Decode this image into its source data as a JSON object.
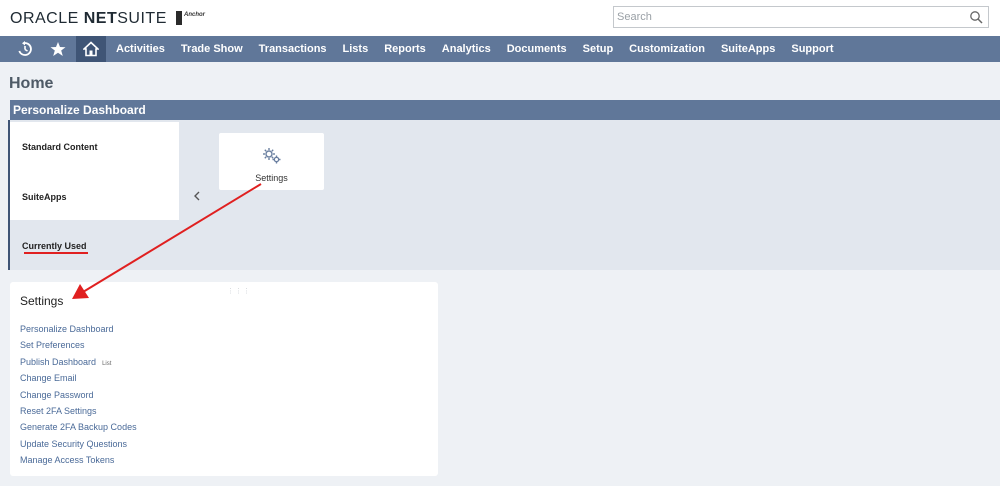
{
  "header": {
    "logo_oracle": "ORACLE ",
    "logo_net": "NET",
    "logo_suite": "SUITE",
    "company_logo_text": "Anchor",
    "search_placeholder": "Search"
  },
  "navbar": {
    "icons": [
      "recent-records-icon",
      "star-icon",
      "home-icon"
    ],
    "items": [
      "Activities",
      "Trade Show",
      "Transactions",
      "Lists",
      "Reports",
      "Analytics",
      "Documents",
      "Setup",
      "Customization",
      "SuiteApps",
      "Support"
    ]
  },
  "page": {
    "title": "Home"
  },
  "personalize": {
    "header": "Personalize Dashboard",
    "menu": [
      "Standard Content",
      "SuiteApps",
      "Currently Used"
    ],
    "tile_label": "Settings"
  },
  "portlet": {
    "title": "Settings",
    "links": [
      "Personalize Dashboard",
      "Set Preferences",
      "Publish Dashboard",
      "Change Email",
      "Change Password",
      "Reset 2FA Settings",
      "Generate 2FA Backup Codes",
      "Update Security Questions",
      "Manage Access Tokens"
    ],
    "publish_tag": "List"
  },
  "colors": {
    "navbar": "#607799",
    "navbar_active": "#3f5576",
    "panel": "#e2e7ee",
    "link": "#4a6a98",
    "annotation": "#e02020"
  }
}
